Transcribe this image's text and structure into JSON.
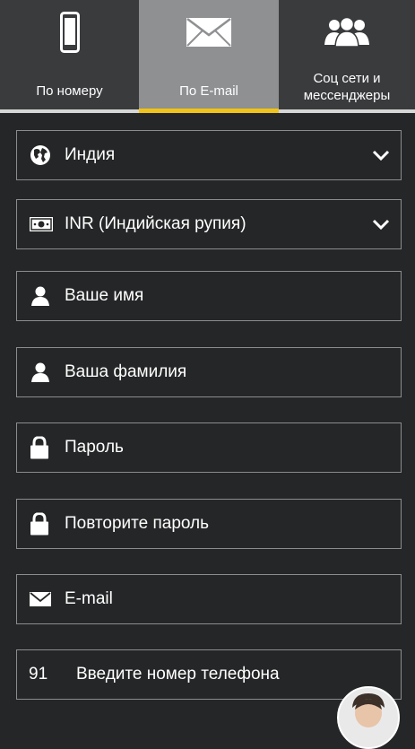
{
  "tabs": [
    {
      "label": "По номеру",
      "icon": "phone-icon"
    },
    {
      "label": "По E-mail",
      "icon": "envelope-icon",
      "active": true
    },
    {
      "label_line1": "Соц сети и",
      "label_line2": "мессенджеры",
      "icon": "people-icon"
    }
  ],
  "form": {
    "country": {
      "value": "Индия",
      "icon": "globe-icon"
    },
    "currency": {
      "value": "INR (Индийская рупия)",
      "icon": "banknote-icon"
    },
    "first_name": {
      "placeholder": "Ваше имя",
      "icon": "user-icon"
    },
    "last_name": {
      "placeholder": "Ваша фамилия",
      "icon": "user-icon"
    },
    "password": {
      "placeholder": "Пароль",
      "icon": "lock-icon"
    },
    "password_repeat": {
      "placeholder": "Повторите пароль",
      "icon": "lock-icon"
    },
    "email": {
      "placeholder": "E-mail",
      "icon": "envelope-icon"
    },
    "phone": {
      "code": "91",
      "placeholder": "Введите номер телефона"
    }
  },
  "colors": {
    "background": "#252627",
    "tab_active": "#8f9092",
    "tab_inactive": "#3a3b3d",
    "accent": "#f0c419",
    "field_border": "#8a8c90"
  }
}
